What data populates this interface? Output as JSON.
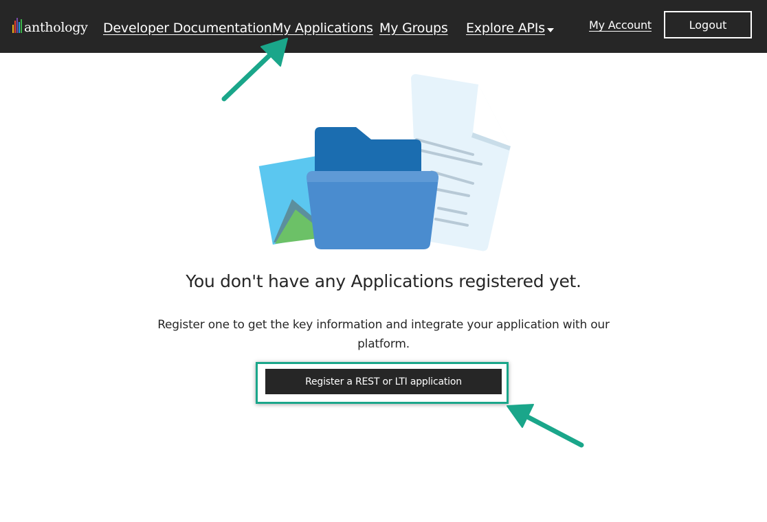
{
  "header": {
    "brand": "anthology",
    "nav": {
      "docs": "Developer Documentation",
      "apps": "My Applications",
      "groups": "My Groups",
      "explore": "Explore APIs"
    },
    "account": "My Account",
    "logout": "Logout"
  },
  "main": {
    "headline": "You don't have any Applications registered yet.",
    "subtext": "Register one to get the key information and integrate your application with our platform.",
    "register_button": "Register a REST or LTI application"
  },
  "colors": {
    "topbar": "#262626",
    "annotation": "#1aa68a",
    "button": "#262626"
  },
  "icons": [
    "logo-bars-icon",
    "chevron-down-icon",
    "empty-folder-illustration",
    "annotation-arrow"
  ]
}
